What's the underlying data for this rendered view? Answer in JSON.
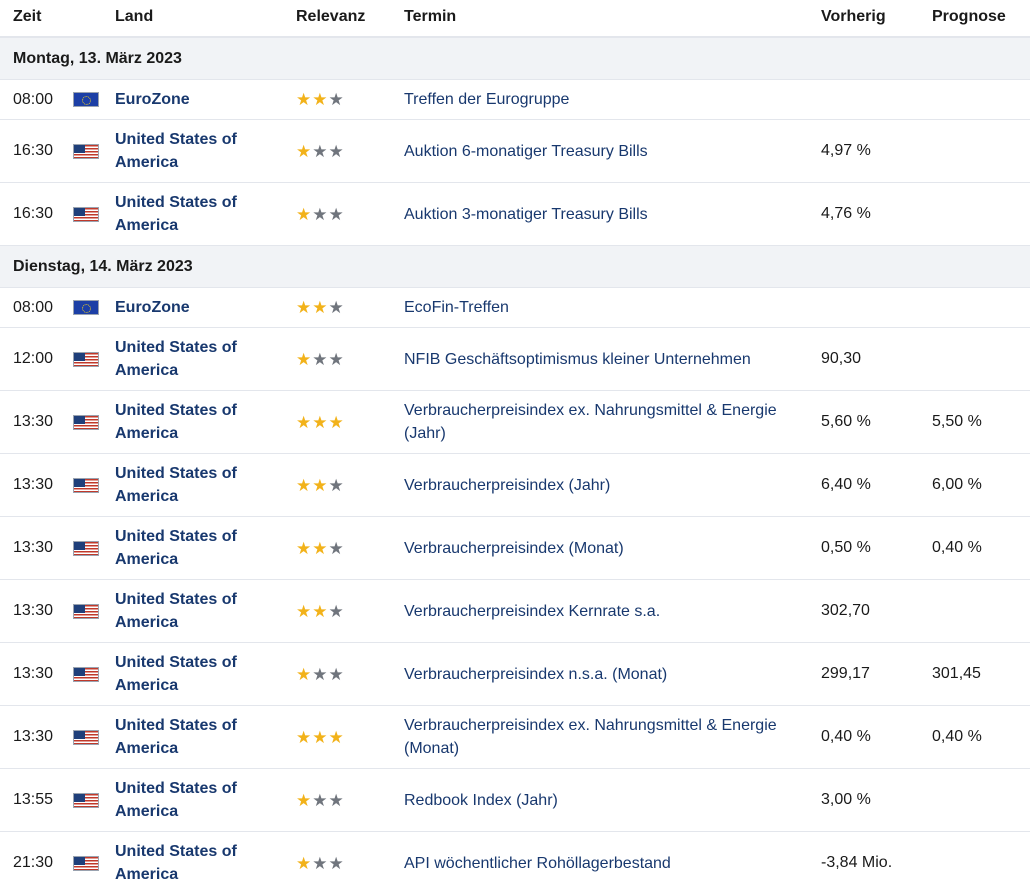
{
  "header": {
    "time": "Zeit",
    "country": "Land",
    "relevance": "Relevanz",
    "event": "Termin",
    "previous": "Vorherig",
    "forecast": "Prognose"
  },
  "groups": [
    {
      "date": "Montag, 13. März 2023",
      "rows": [
        {
          "time": "08:00",
          "flag": "eu",
          "country": "EuroZone",
          "stars": 2,
          "event": "Treffen der Eurogruppe",
          "previous": "",
          "forecast": ""
        },
        {
          "time": "16:30",
          "flag": "us",
          "country": "United States of America",
          "stars": 1,
          "event": "Auktion 6-monatiger Treasury Bills",
          "previous": "4,97 %",
          "forecast": ""
        },
        {
          "time": "16:30",
          "flag": "us",
          "country": "United States of America",
          "stars": 1,
          "event": "Auktion 3-monatiger Treasury Bills",
          "previous": "4,76 %",
          "forecast": ""
        }
      ]
    },
    {
      "date": "Dienstag, 14. März 2023",
      "rows": [
        {
          "time": "08:00",
          "flag": "eu",
          "country": "EuroZone",
          "stars": 2,
          "event": "EcoFin-Treffen",
          "previous": "",
          "forecast": ""
        },
        {
          "time": "12:00",
          "flag": "us",
          "country": "United States of America",
          "stars": 1,
          "event": "NFIB Geschäftsoptimismus kleiner Unternehmen",
          "previous": "90,30",
          "forecast": ""
        },
        {
          "time": "13:30",
          "flag": "us",
          "country": "United States of America",
          "stars": 3,
          "event": "Verbraucherpreisindex ex. Nahrungsmittel & Energie (Jahr)",
          "previous": "5,60 %",
          "forecast": "5,50 %"
        },
        {
          "time": "13:30",
          "flag": "us",
          "country": "United States of America",
          "stars": 2,
          "event": "Verbraucherpreisindex (Jahr)",
          "previous": "6,40 %",
          "forecast": "6,00 %"
        },
        {
          "time": "13:30",
          "flag": "us",
          "country": "United States of America",
          "stars": 2,
          "event": "Verbraucherpreisindex (Monat)",
          "previous": "0,50 %",
          "forecast": "0,40 %"
        },
        {
          "time": "13:30",
          "flag": "us",
          "country": "United States of America",
          "stars": 2,
          "event": "Verbraucherpreisindex Kernrate s.a.",
          "previous": "302,70",
          "forecast": ""
        },
        {
          "time": "13:30",
          "flag": "us",
          "country": "United States of America",
          "stars": 1,
          "event": "Verbraucherpreisindex n.s.a. (Monat)",
          "previous": "299,17",
          "forecast": "301,45"
        },
        {
          "time": "13:30",
          "flag": "us",
          "country": "United States of America",
          "stars": 3,
          "event": "Verbraucherpreisindex ex. Nahrungsmittel & Energie (Monat)",
          "previous": "0,40 %",
          "forecast": "0,40 %"
        },
        {
          "time": "13:55",
          "flag": "us",
          "country": "United States of America",
          "stars": 1,
          "event": "Redbook Index (Jahr)",
          "previous": "3,00 %",
          "forecast": ""
        },
        {
          "time": "21:30",
          "flag": "us",
          "country": "United States of America",
          "stars": 1,
          "event": "API wöchentlicher Rohöllagerbestand",
          "previous": "-3,84 Mio.",
          "forecast": ""
        }
      ]
    }
  ],
  "colors": {
    "link": "#18386e",
    "star_on": "#f2b21a",
    "star_off": "#70757d",
    "group_bg": "#f1f3f6",
    "divider": "#e3e6ec"
  },
  "icons": {
    "star": "★",
    "flag_eu": "eu-flag-icon",
    "flag_us": "us-flag-icon"
  }
}
